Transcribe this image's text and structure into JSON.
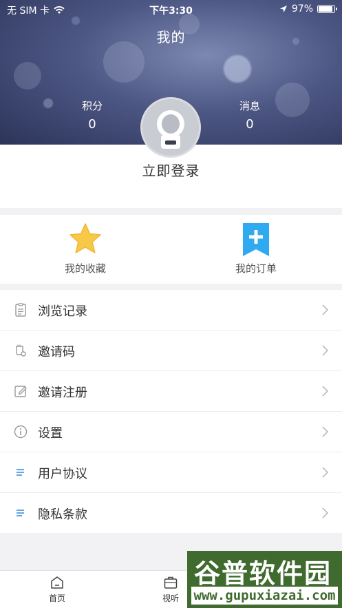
{
  "status_bar": {
    "carrier": "无 SIM 卡",
    "time": "下午3:30",
    "battery": "97%"
  },
  "header": {
    "title": "我的"
  },
  "stats": {
    "points_label": "积分",
    "points_value": "0",
    "messages_label": "消息",
    "messages_value": "0"
  },
  "login": {
    "label": "立即登录"
  },
  "quick_actions": {
    "favorites_label": "我的收藏",
    "orders_label": "我的订单"
  },
  "menu": {
    "items": [
      {
        "label": "浏览记录",
        "icon": "history-icon"
      },
      {
        "label": "邀请码",
        "icon": "invite-code-icon"
      },
      {
        "label": "邀请注册",
        "icon": "edit-icon"
      },
      {
        "label": "设置",
        "icon": "info-icon"
      },
      {
        "label": "用户协议",
        "icon": "list-icon"
      },
      {
        "label": "隐私条款",
        "icon": "list-icon"
      }
    ]
  },
  "tabbar": {
    "home_label": "首页",
    "video_label": "视听"
  },
  "watermark": {
    "title": "谷普软件园",
    "url": "www.gupuxiazai.com"
  },
  "colors": {
    "star": "#f7c948",
    "bookmark": "#2fa9f0",
    "list_icon": "#3b8de0"
  }
}
